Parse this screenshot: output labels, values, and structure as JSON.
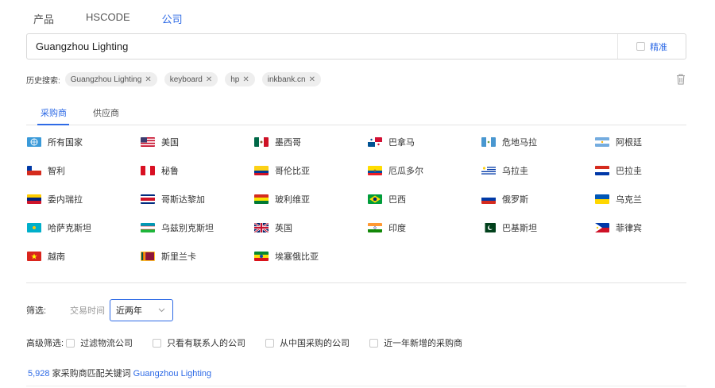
{
  "top_tabs": [
    {
      "label": "产品"
    },
    {
      "label": "HSCODE"
    },
    {
      "label": "公司"
    }
  ],
  "search": {
    "value": "Guangzhou Lighting",
    "exact_label": "精准"
  },
  "history": {
    "label": "历史搜索:",
    "items": [
      "Guangzhou Lighting",
      "keyboard",
      "hp",
      "inkbank.cn"
    ],
    "close_glyph": "✕"
  },
  "sub_tabs": [
    {
      "label": "采购商"
    },
    {
      "label": "供应商"
    }
  ],
  "countries": [
    {
      "label": "所有国家",
      "icon": "globe-icon"
    },
    {
      "label": "美国",
      "icon": "flag-us-icon"
    },
    {
      "label": "墨西哥",
      "icon": "flag-mx-icon"
    },
    {
      "label": "巴拿马",
      "icon": "flag-pa-icon"
    },
    {
      "label": "危地马拉",
      "icon": "flag-gt-icon"
    },
    {
      "label": "阿根廷",
      "icon": "flag-ar-icon"
    },
    {
      "label": "智利",
      "icon": "flag-cl-icon"
    },
    {
      "label": "秘鲁",
      "icon": "flag-pe-icon"
    },
    {
      "label": "哥伦比亚",
      "icon": "flag-co-icon"
    },
    {
      "label": "厄瓜多尔",
      "icon": "flag-ec-icon"
    },
    {
      "label": "乌拉圭",
      "icon": "flag-uy-icon"
    },
    {
      "label": "巴拉圭",
      "icon": "flag-py-icon"
    },
    {
      "label": "委内瑞拉",
      "icon": "flag-ve-icon"
    },
    {
      "label": "哥斯达黎加",
      "icon": "flag-cr-icon"
    },
    {
      "label": "玻利维亚",
      "icon": "flag-bo-icon"
    },
    {
      "label": "巴西",
      "icon": "flag-br-icon"
    },
    {
      "label": "俄罗斯",
      "icon": "flag-ru-icon"
    },
    {
      "label": "乌克兰",
      "icon": "flag-ua-icon"
    },
    {
      "label": "哈萨克斯坦",
      "icon": "flag-kz-icon"
    },
    {
      "label": "乌兹别克斯坦",
      "icon": "flag-uz-icon"
    },
    {
      "label": "英国",
      "icon": "flag-gb-icon"
    },
    {
      "label": "印度",
      "icon": "flag-in-icon"
    },
    {
      "label": "巴基斯坦",
      "icon": "flag-pk-icon"
    },
    {
      "label": "菲律宾",
      "icon": "flag-ph-icon"
    },
    {
      "label": "越南",
      "icon": "flag-vn-icon"
    },
    {
      "label": "斯里兰卡",
      "icon": "flag-lk-icon"
    },
    {
      "label": "埃塞俄比亚",
      "icon": "flag-et-icon"
    }
  ],
  "filter": {
    "label": "筛选:",
    "trade_time_label": "交易时间",
    "trade_time_value": "近两年"
  },
  "advanced": {
    "label": "高级筛选:",
    "options": [
      "过滤物流公司",
      "只看有联系人的公司",
      "从中国采购的公司",
      "近一年新增的采购商"
    ]
  },
  "result": {
    "count": "5,928",
    "text": "家采购商匹配关键词",
    "keyword": "Guangzhou Lighting"
  },
  "colors": {
    "accent": "#2f6be6"
  }
}
